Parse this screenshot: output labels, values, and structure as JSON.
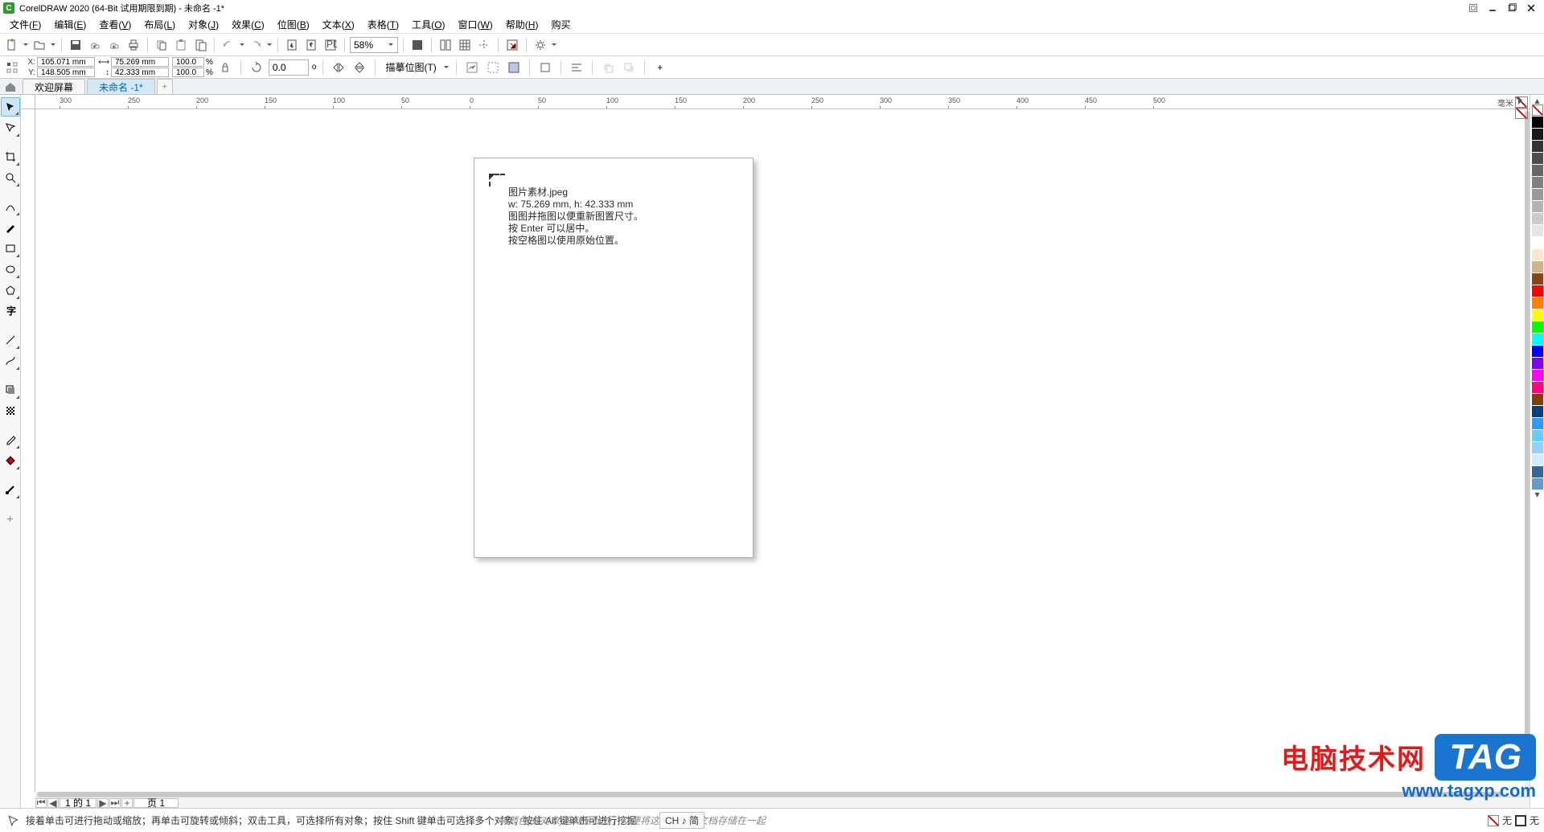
{
  "title": "CorelDRAW 2020 (64-Bit 试用期限到期) - 未命名 -1*",
  "menus": [
    {
      "label": "文件",
      "hot": "F"
    },
    {
      "label": "编辑",
      "hot": "E"
    },
    {
      "label": "查看",
      "hot": "V"
    },
    {
      "label": "布局",
      "hot": "L"
    },
    {
      "label": "对象",
      "hot": "J"
    },
    {
      "label": "效果",
      "hot": "C"
    },
    {
      "label": "位图",
      "hot": "B"
    },
    {
      "label": "文本",
      "hot": "X"
    },
    {
      "label": "表格",
      "hot": "T"
    },
    {
      "label": "工具",
      "hot": "O"
    },
    {
      "label": "窗口",
      "hot": "W"
    },
    {
      "label": "帮助",
      "hot": "H"
    },
    {
      "label": "购买",
      "hot": ""
    }
  ],
  "toolbar": {
    "zoom": "58%"
  },
  "propbar": {
    "x": "105.071 mm",
    "y": "148.505 mm",
    "w": "75.269 mm",
    "h": "42.333 mm",
    "sx": "100.0",
    "sy": "100.0",
    "pct": "%",
    "rotate": "0.0",
    "deg": "o",
    "trace_label": "描摹位图(T)"
  },
  "tabs": {
    "welcome": "欢迎屏幕",
    "doc": "未命名 -1*"
  },
  "ruler_unit": "毫米",
  "ruler_h": [
    "300",
    "250",
    "200",
    "150",
    "100",
    "50",
    "0",
    "50",
    "100",
    "150",
    "200",
    "250",
    "300",
    "350",
    "400",
    "450",
    "500"
  ],
  "import_hint": {
    "file": "图片素材.jpeg",
    "size": "w: 75.269 mm, h: 42.333 mm",
    "l1": "图图并拖图以便重新图置尺寸。",
    "l2": "按 Enter 可以居中。",
    "l3": "按空格图以使用原始位置。"
  },
  "pagenav": {
    "count": "1 的 1",
    "page": "页 1"
  },
  "status": {
    "hint": "接着单击可进行拖动或缩放；再单击可旋转或倾斜；双击工具，可选择所有对象；按住 Shift 键单击可选择多个对象；按住 Alt 键单击可进行挖掘",
    "colordrop": "将颜色(或对象)拖动至此处，以便将这些颜色与文档存储在一起",
    "ime": "CH ♪ 简",
    "none": "无"
  },
  "palette": [
    "#000000",
    "#1a1a1a",
    "#333333",
    "#4d4d4d",
    "#666666",
    "#808080",
    "#999999",
    "#b3b3b3",
    "#cccccc",
    "#e6e6e6",
    "#ffffff",
    "#f7e7ce",
    "#d2b48c",
    "#8b4513",
    "#ff0000",
    "#ff8000",
    "#ffff00",
    "#00ff00",
    "#00ffff",
    "#0000ff",
    "#8000ff",
    "#ff00ff",
    "#ff0080",
    "#804000",
    "#004080",
    "#3399ff",
    "#66ccff",
    "#99ccff",
    "#cceeff",
    "#336699",
    "#6699cc"
  ],
  "watermark": {
    "cn": "电脑技术网",
    "tag": "TAG",
    "url": "www.tagxp.com"
  }
}
